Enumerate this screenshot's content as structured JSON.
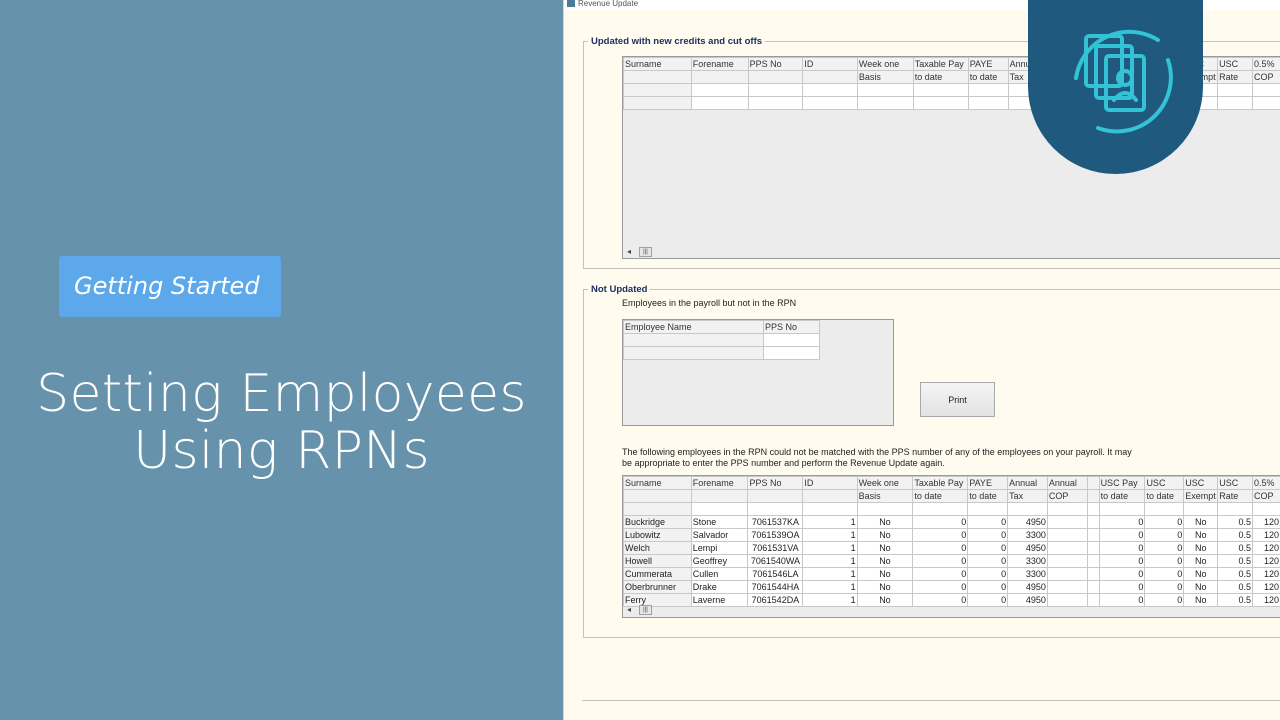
{
  "left_panel": {
    "badge": "Getting Started",
    "title_line1": "Setting Employees",
    "title_line2": "Using RPNs"
  },
  "window": {
    "title": "Revenue Update",
    "updated_section": {
      "legend": "Updated with new credits and cut offs",
      "headers_top": [
        "Surname",
        "Forename",
        "PPS No",
        "ID",
        "Week one",
        "Taxable Pay",
        "PAYE",
        "Annu",
        "",
        "",
        "",
        "",
        "USC",
        "USC",
        "0.5%"
      ],
      "headers_bottom": [
        "",
        "",
        "",
        "",
        "Basis",
        "to date",
        "to date",
        "Tax",
        "",
        "",
        "",
        "",
        "Exempt",
        "Rate",
        "COP"
      ]
    },
    "not_updated_section": {
      "legend": "Not Updated",
      "note1": "Employees in the payroll but not in the RPN",
      "emp_headers": [
        "Employee Name",
        "PPS No"
      ],
      "print_label": "Print",
      "note2": "The following employees in the RPN could not be matched with the PPS number of any of the employees on your payroll. It may be appropriate to enter the PPS number and perform the Revenue Update again.",
      "headers_top": [
        "Surname",
        "Forename",
        "PPS No",
        "ID",
        "Week one",
        "Taxable Pay",
        "PAYE",
        "Annual",
        "Annual",
        "",
        "USC Pay",
        "USC",
        "USC",
        "USC",
        "0.5%"
      ],
      "headers_bottom": [
        "",
        "",
        "",
        "",
        "Basis",
        "to date",
        "to date",
        "Tax",
        "COP",
        "",
        "to date",
        "to date",
        "Exempt",
        "Rate",
        "COP"
      ],
      "rows": [
        {
          "surname": "Buckridge",
          "forename": "Stone",
          "pps": "7061537KA",
          "id": "1",
          "week_one": "No",
          "taxable": "0",
          "paye": "0",
          "annual_tax": "4950",
          "usc_pay": "0",
          "usc_to_date": "0",
          "usc_exempt": "No",
          "usc_rate": "0.5",
          "cop": "120"
        },
        {
          "surname": "Lubowitz",
          "forename": "Salvador",
          "pps": "7061539OA",
          "id": "1",
          "week_one": "No",
          "taxable": "0",
          "paye": "0",
          "annual_tax": "3300",
          "usc_pay": "0",
          "usc_to_date": "0",
          "usc_exempt": "No",
          "usc_rate": "0.5",
          "cop": "120"
        },
        {
          "surname": "Welch",
          "forename": "Lempi",
          "pps": "7061531VA",
          "id": "1",
          "week_one": "No",
          "taxable": "0",
          "paye": "0",
          "annual_tax": "4950",
          "usc_pay": "0",
          "usc_to_date": "0",
          "usc_exempt": "No",
          "usc_rate": "0.5",
          "cop": "120"
        },
        {
          "surname": "Howell",
          "forename": "Geoffrey",
          "pps": "7061540WA",
          "id": "1",
          "week_one": "No",
          "taxable": "0",
          "paye": "0",
          "annual_tax": "3300",
          "usc_pay": "0",
          "usc_to_date": "0",
          "usc_exempt": "No",
          "usc_rate": "0.5",
          "cop": "120"
        },
        {
          "surname": "Cummerata",
          "forename": "Cullen",
          "pps": "7061546LA",
          "id": "1",
          "week_one": "No",
          "taxable": "0",
          "paye": "0",
          "annual_tax": "3300",
          "usc_pay": "0",
          "usc_to_date": "0",
          "usc_exempt": "No",
          "usc_rate": "0.5",
          "cop": "120"
        },
        {
          "surname": "Oberbrunner",
          "forename": "Drake",
          "pps": "7061544HA",
          "id": "1",
          "week_one": "No",
          "taxable": "0",
          "paye": "0",
          "annual_tax": "4950",
          "usc_pay": "0",
          "usc_to_date": "0",
          "usc_exempt": "No",
          "usc_rate": "0.5",
          "cop": "120"
        },
        {
          "surname": "Ferry",
          "forename": "Laverne",
          "pps": "7061542DA",
          "id": "1",
          "week_one": "No",
          "taxable": "0",
          "paye": "0",
          "annual_tax": "4950",
          "usc_pay": "0",
          "usc_to_date": "0",
          "usc_exempt": "No",
          "usc_rate": "0.5",
          "cop": "120"
        }
      ]
    }
  },
  "logo": {
    "icon": "document-id-card-icon",
    "color": "#1f5a7e",
    "accent": "#33c2d6"
  }
}
